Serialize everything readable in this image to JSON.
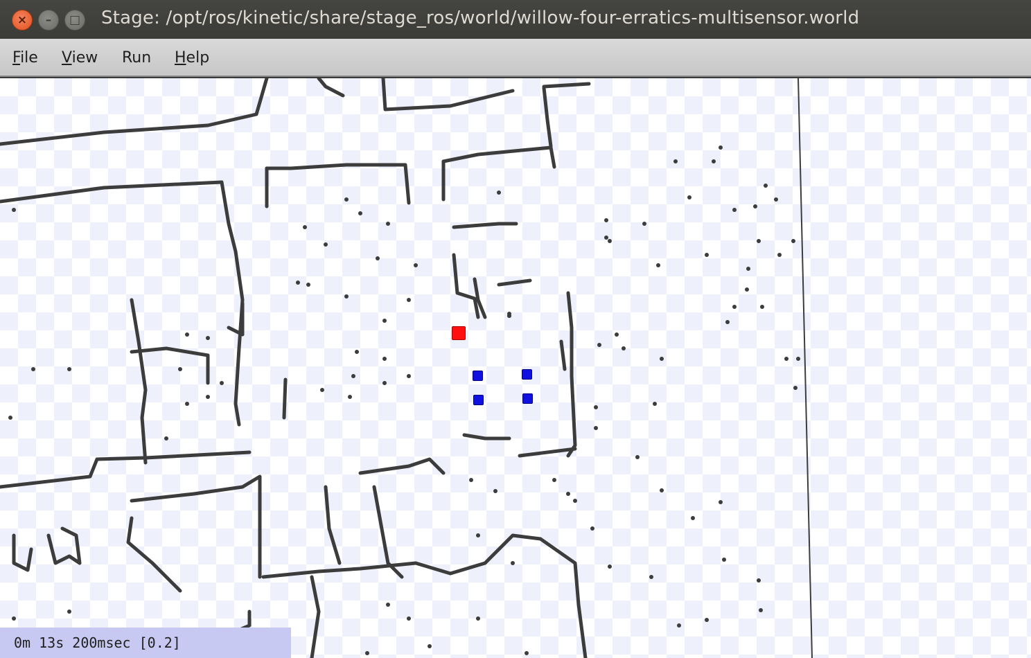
{
  "window": {
    "title": "Stage: /opt/ros/kinetic/share/stage_ros/world/willow-four-erratics-multisensor.world",
    "controls": [
      "close-icon",
      "minimize-icon",
      "maximize-icon"
    ]
  },
  "menubar": {
    "items": [
      {
        "label": "File",
        "mnemonic": "F"
      },
      {
        "label": "View",
        "mnemonic": "V"
      },
      {
        "label": "Run",
        "mnemonic": ""
      },
      {
        "label": "Help",
        "mnemonic": "H"
      }
    ]
  },
  "world": {
    "robots": [
      {
        "id": "red-robot",
        "color": "#ff1010"
      },
      {
        "id": "blue-robot-1",
        "color": "#1010e0"
      },
      {
        "id": "blue-robot-2",
        "color": "#1010e0"
      },
      {
        "id": "blue-robot-3",
        "color": "#1010e0"
      },
      {
        "id": "blue-robot-4",
        "color": "#1010e0"
      }
    ],
    "wall_color": "#3c3c3c",
    "floor_checker_color": "#eef0fb"
  },
  "status": {
    "text": "0m 13s 200msec [0.2]"
  }
}
